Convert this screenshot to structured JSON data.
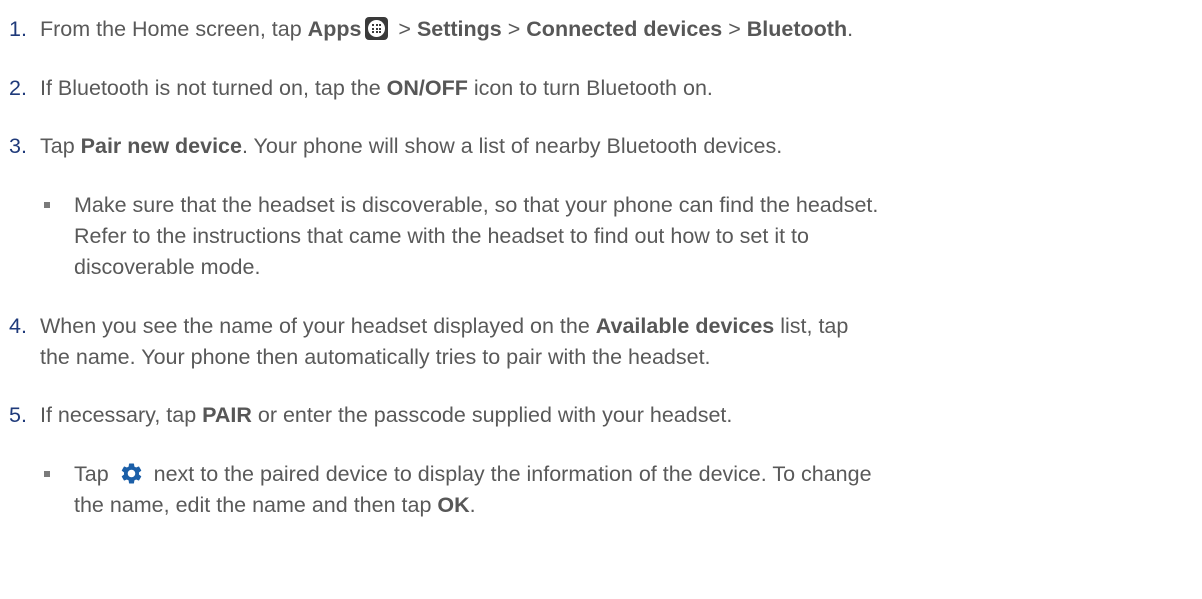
{
  "steps": [
    {
      "number": "1.",
      "parts": {
        "a": "From the Home screen, tap ",
        "b": "Apps",
        "c": " > ",
        "d": "Settings",
        "e": " > ",
        "f": "Connected devices",
        "g": " > ",
        "h": "Bluetooth",
        "i": "."
      },
      "icon": "apps-grid-icon"
    },
    {
      "number": "2.",
      "parts": {
        "a": "If Bluetooth is not turned on, tap the ",
        "b": "ON/OFF",
        "c": " icon to turn Bluetooth on."
      }
    },
    {
      "number": "3.",
      "parts": {
        "a": "Tap ",
        "b": "Pair new device",
        "c": ". Your phone will show a list of nearby Bluetooth devices."
      },
      "sub": {
        "line1": "Make sure that the headset is discoverable, so that your phone can find the headset.",
        "line2": "Refer to the instructions that came with the headset to find out how to set it to",
        "line3": "discoverable mode."
      }
    },
    {
      "number": "4.",
      "parts": {
        "a": "When you see the name of your headset displayed on the ",
        "b": "Available devices",
        "c": " list, tap",
        "d": "the name. Your phone then automatically tries to pair with the headset."
      }
    },
    {
      "number": "5.",
      "parts": {
        "a": "If necessary, tap ",
        "b": "PAIR",
        "c": " or enter the passcode supplied with your headset."
      },
      "sub": {
        "a": "Tap ",
        "b": " next to the paired device to display the information of the device. To change",
        "c": "the name, edit the name and then tap ",
        "d": "OK",
        "e": "."
      },
      "icon": "gear-icon"
    }
  ],
  "colors": {
    "number": "#1f3a7a",
    "text": "#595959",
    "gear": "#1b5fa8"
  }
}
